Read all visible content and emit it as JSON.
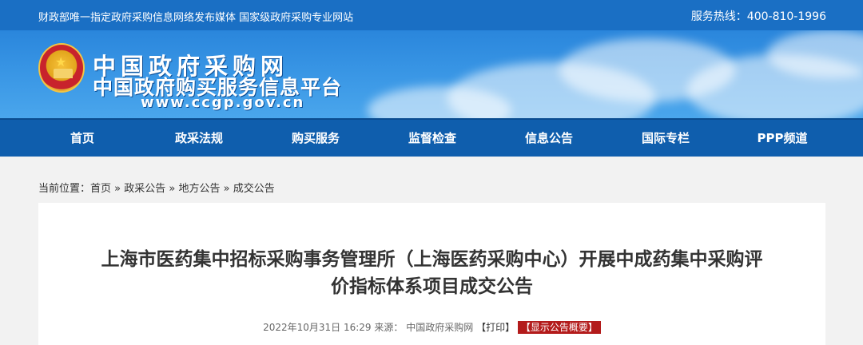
{
  "topbar": {
    "slogan": "财政部唯一指定政府采购信息网络发布媒体 国家级政府采购专业网站",
    "hotline": "服务热线：400-810-1996"
  },
  "brand": {
    "name": "中国政府采购网",
    "subtitle": "中国政府购买服务信息平台",
    "url": "www.ccgp.gov.cn"
  },
  "nav": [
    "首页",
    "政采法规",
    "购买服务",
    "监督检查",
    "信息公告",
    "国际专栏",
    "PPP频道"
  ],
  "breadcrumb": {
    "prefix": "当前位置：",
    "items": [
      "首页",
      "政采公告",
      "地方公告",
      "成交公告"
    ],
    "sep": " » "
  },
  "article": {
    "title_line1": "上海市医药集中招标采购事务管理所（上海医药采购中心）开展中成药集中采购评",
    "title_line2": "价指标体系项目成交公告",
    "datetime": "2022年10月31日 16:29",
    "source_label": "来源：",
    "source": "中国政府采购网",
    "print_label": "【打印】",
    "summary_label": "【显示公告概要】"
  }
}
